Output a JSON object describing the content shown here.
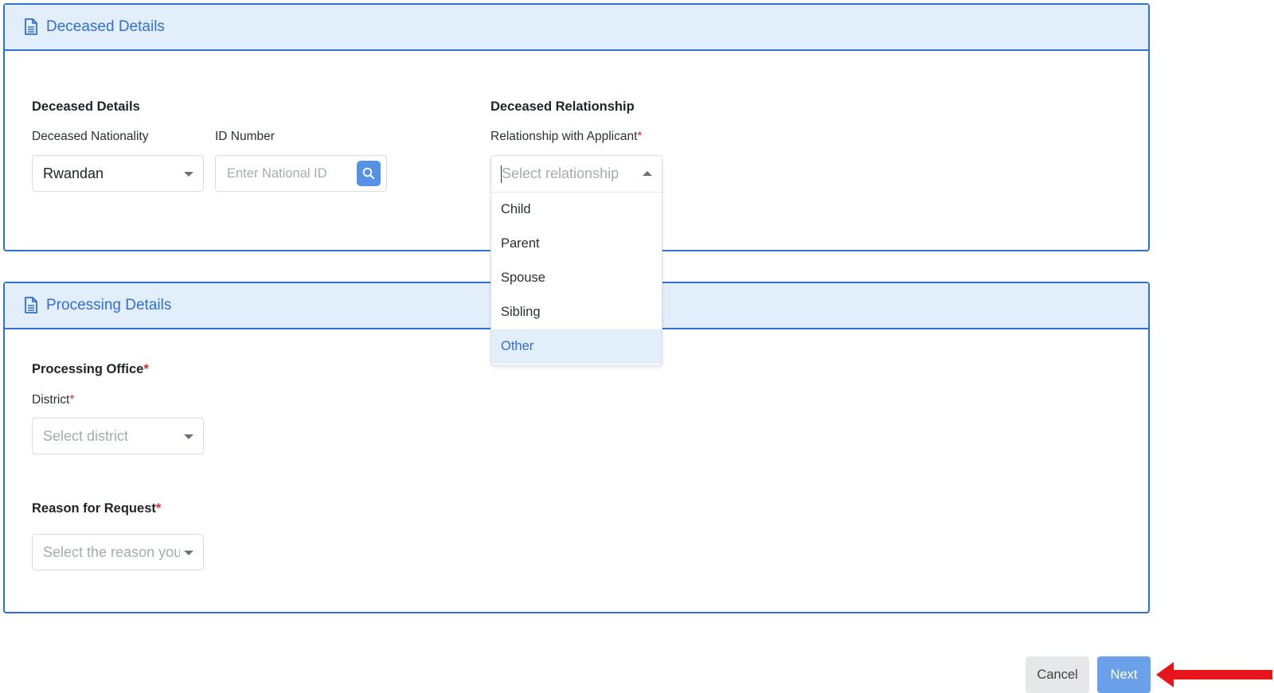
{
  "deceased_card": {
    "header_title": "Deceased Details",
    "section_left_title": "Deceased Details",
    "nationality_label": "Deceased Nationality",
    "nationality_value": "Rwandan",
    "id_label": "ID Number",
    "id_placeholder": "Enter National ID",
    "section_right_title": "Deceased Relationship",
    "relationship_label": "Relationship with Applicant",
    "relationship_required": "*",
    "relationship_placeholder": "Select relationship",
    "relationship_options": [
      "Child",
      "Parent",
      "Spouse",
      "Sibling",
      "Other"
    ],
    "relationship_highlighted": "Other"
  },
  "processing_card": {
    "header_title": "Processing Details",
    "office_title": "Processing Office",
    "office_required": "*",
    "district_label": "District",
    "district_required": "*",
    "district_placeholder": "Select district",
    "reason_title": "Reason for Request",
    "reason_required": "*",
    "reason_placeholder": "Select the reason you"
  },
  "actions": {
    "cancel_label": "Cancel",
    "next_label": "Next"
  },
  "colors": {
    "accent": "#2f6fd6",
    "header_bg": "#e3eefb",
    "required": "#d9302a",
    "next_button": "#6ba1ea",
    "annotation_arrow": "#e8131b"
  },
  "icons": {
    "card_header": "document-icon",
    "id_search": "search-icon",
    "annotation": "red-arrow-icon"
  }
}
